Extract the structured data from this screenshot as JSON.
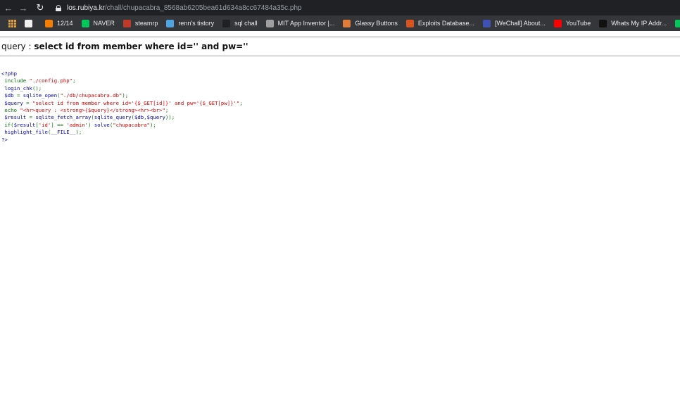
{
  "browser": {
    "url_host": "los.rubiya.kr",
    "url_path": "/chall/chupacabra_8568ab6205bea61d634a8cc67484a35c.php",
    "bookmarks": [
      {
        "label": "",
        "icon": "apps-icon"
      },
      {
        "label": "",
        "icon": "blog-icon",
        "color": "#f0f0f0"
      },
      {
        "label": "12/14",
        "icon": "blogger-icon",
        "color": "#f57d00"
      },
      {
        "label": "NAVER",
        "icon": "naver-icon",
        "color": "#03c75a"
      },
      {
        "label": "steamrp",
        "icon": "steam-icon",
        "color": "#c0392b"
      },
      {
        "label": "renn's tistory",
        "icon": "tistory-icon",
        "color": "#4fa3e0"
      },
      {
        "label": "sql chall",
        "icon": "z-icon",
        "color": "#202124"
      },
      {
        "label": "MIT App Inventor |...",
        "icon": "appinventor-icon",
        "color": "#a0a0a0"
      },
      {
        "label": "Glassy Buttons",
        "icon": "glassy-icon",
        "color": "#e07b39"
      },
      {
        "label": "Exploits Database...",
        "icon": "exploitdb-icon",
        "color": "#d9531e"
      },
      {
        "label": "[WeChall] About...",
        "icon": "wechall-icon",
        "color": "#3f51b5"
      },
      {
        "label": "YouTube",
        "icon": "youtube-icon",
        "color": "#ff0000"
      },
      {
        "label": "Whats My IP Addr...",
        "icon": "ip-icon",
        "color": "#111111"
      },
      {
        "label": "NAVER",
        "icon": "naver-icon",
        "color": "#03c75a"
      }
    ]
  },
  "page": {
    "query_prefix": "query : ",
    "query_text": "select id from member where id='' and pw=''",
    "code_lines": [
      [
        {
          "t": "tag",
          "v": "<?php"
        }
      ],
      [
        {
          "t": "key",
          "v": " include "
        },
        {
          "t": "str",
          "v": "\"./config.php\""
        },
        {
          "t": "key",
          "v": ";"
        }
      ],
      [
        {
          "t": "def",
          "v": " login_chk"
        },
        {
          "t": "key",
          "v": "();"
        }
      ],
      [
        {
          "t": "def",
          "v": " $db "
        },
        {
          "t": "key",
          "v": "= "
        },
        {
          "t": "def",
          "v": "sqlite_open"
        },
        {
          "t": "key",
          "v": "("
        },
        {
          "t": "str",
          "v": "\"./db/chupacabra.db\""
        },
        {
          "t": "key",
          "v": ");"
        }
      ],
      [
        {
          "t": "def",
          "v": " $query "
        },
        {
          "t": "key",
          "v": "= "
        },
        {
          "t": "str",
          "v": "\"select id from member where id='{$_GET[id]}' and pw='{$_GET[pw]}'\""
        },
        {
          "t": "key",
          "v": ";"
        }
      ],
      [
        {
          "t": "key",
          "v": " echo "
        },
        {
          "t": "str",
          "v": "\"<hr>query : <strong>{$query}</strong><hr><br>\""
        },
        {
          "t": "key",
          "v": ";"
        }
      ],
      [
        {
          "t": "def",
          "v": " $result "
        },
        {
          "t": "key",
          "v": "= "
        },
        {
          "t": "def",
          "v": "sqlite_fetch_array"
        },
        {
          "t": "key",
          "v": "("
        },
        {
          "t": "def",
          "v": "sqlite_query"
        },
        {
          "t": "key",
          "v": "("
        },
        {
          "t": "def",
          "v": "$db"
        },
        {
          "t": "key",
          "v": ","
        },
        {
          "t": "def",
          "v": "$query"
        },
        {
          "t": "key",
          "v": "));"
        }
      ],
      [
        {
          "t": "key",
          "v": " if("
        },
        {
          "t": "def",
          "v": "$result"
        },
        {
          "t": "key",
          "v": "["
        },
        {
          "t": "str",
          "v": "'id'"
        },
        {
          "t": "key",
          "v": "] == "
        },
        {
          "t": "str",
          "v": "'admin'"
        },
        {
          "t": "key",
          "v": ") "
        },
        {
          "t": "def",
          "v": "solve"
        },
        {
          "t": "key",
          "v": "("
        },
        {
          "t": "str",
          "v": "\"chupacabra\""
        },
        {
          "t": "key",
          "v": ");"
        }
      ],
      [
        {
          "t": "def",
          "v": " highlight_file"
        },
        {
          "t": "key",
          "v": "("
        },
        {
          "t": "def",
          "v": "__FILE__"
        },
        {
          "t": "key",
          "v": ");"
        }
      ],
      [
        {
          "t": "tag",
          "v": "?>"
        }
      ]
    ]
  }
}
